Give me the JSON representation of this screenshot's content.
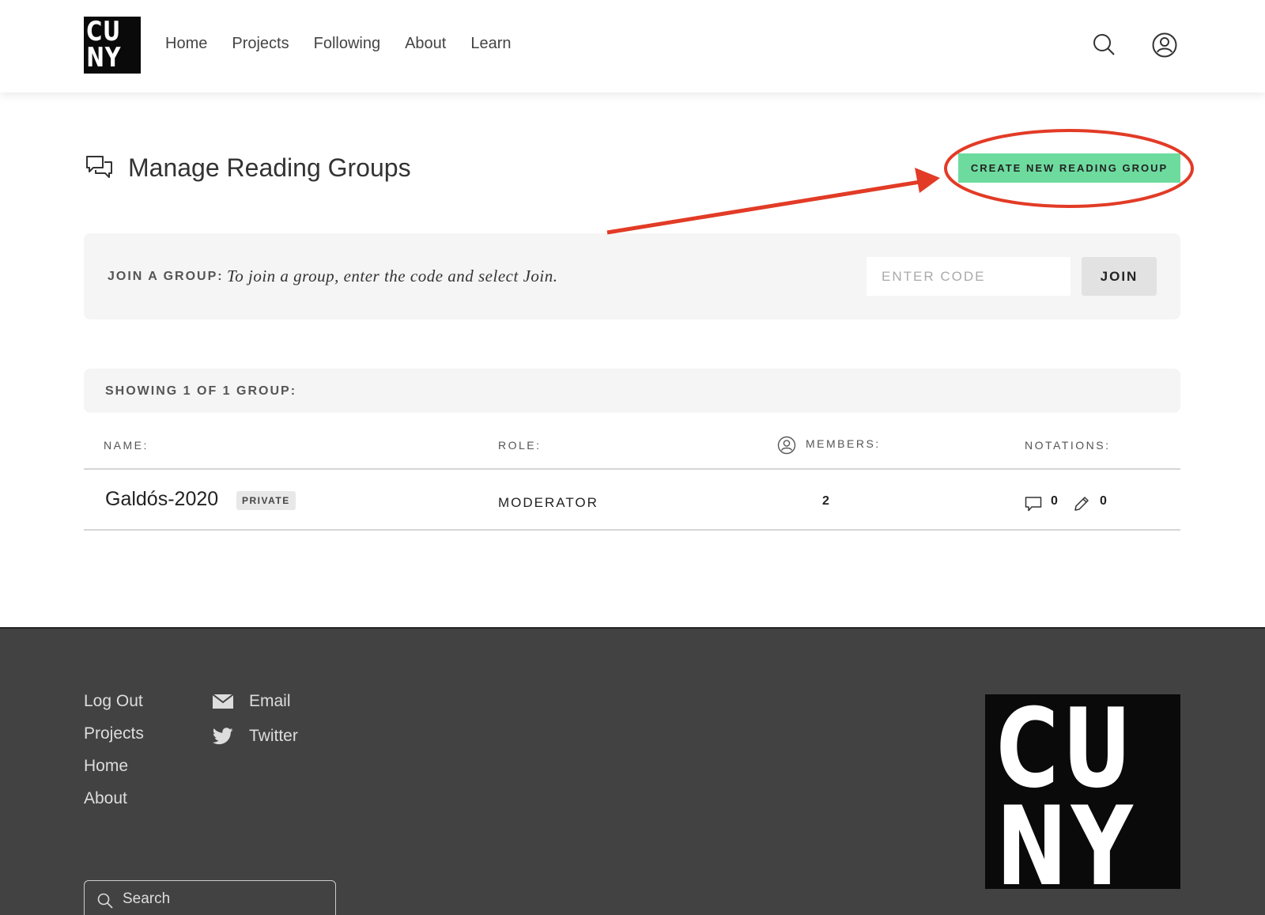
{
  "header": {
    "logo": {
      "line1": "CU",
      "line2": "NY"
    },
    "nav": [
      "Home",
      "Projects",
      "Following",
      "About",
      "Learn"
    ],
    "icons": {
      "search": "search-icon",
      "user": "user-icon"
    }
  },
  "main": {
    "title": "Manage Reading Groups",
    "title_icon": "chat-bubbles-icon",
    "create_button": "CREATE NEW READING GROUP",
    "join": {
      "label": "JOIN A GROUP:",
      "instruction": "To join a group, enter the code and select Join.",
      "placeholder": "ENTER CODE",
      "button": "JOIN"
    },
    "showing": "SHOWING 1 OF 1 GROUP:",
    "columns": {
      "name": "NAME:",
      "role": "ROLE:",
      "members": "MEMBERS:",
      "notations": "NOTATIONS:"
    },
    "rows": [
      {
        "name": "Galdós-2020",
        "badge": "PRIVATE",
        "role": "MODERATOR",
        "members": "2",
        "comments": "0",
        "highlights": "0"
      }
    ]
  },
  "footer": {
    "links": [
      "Log Out",
      "Projects",
      "Home",
      "About"
    ],
    "social": [
      {
        "label": "Email",
        "icon": "email-icon"
      },
      {
        "label": "Twitter",
        "icon": "twitter-icon"
      }
    ],
    "search_placeholder": "Search",
    "logo": {
      "line1": "CU",
      "line2": "NY"
    }
  },
  "colors": {
    "accent": "#6ddb9e",
    "annotation": "#e23b26",
    "footer_bg": "#424242"
  }
}
